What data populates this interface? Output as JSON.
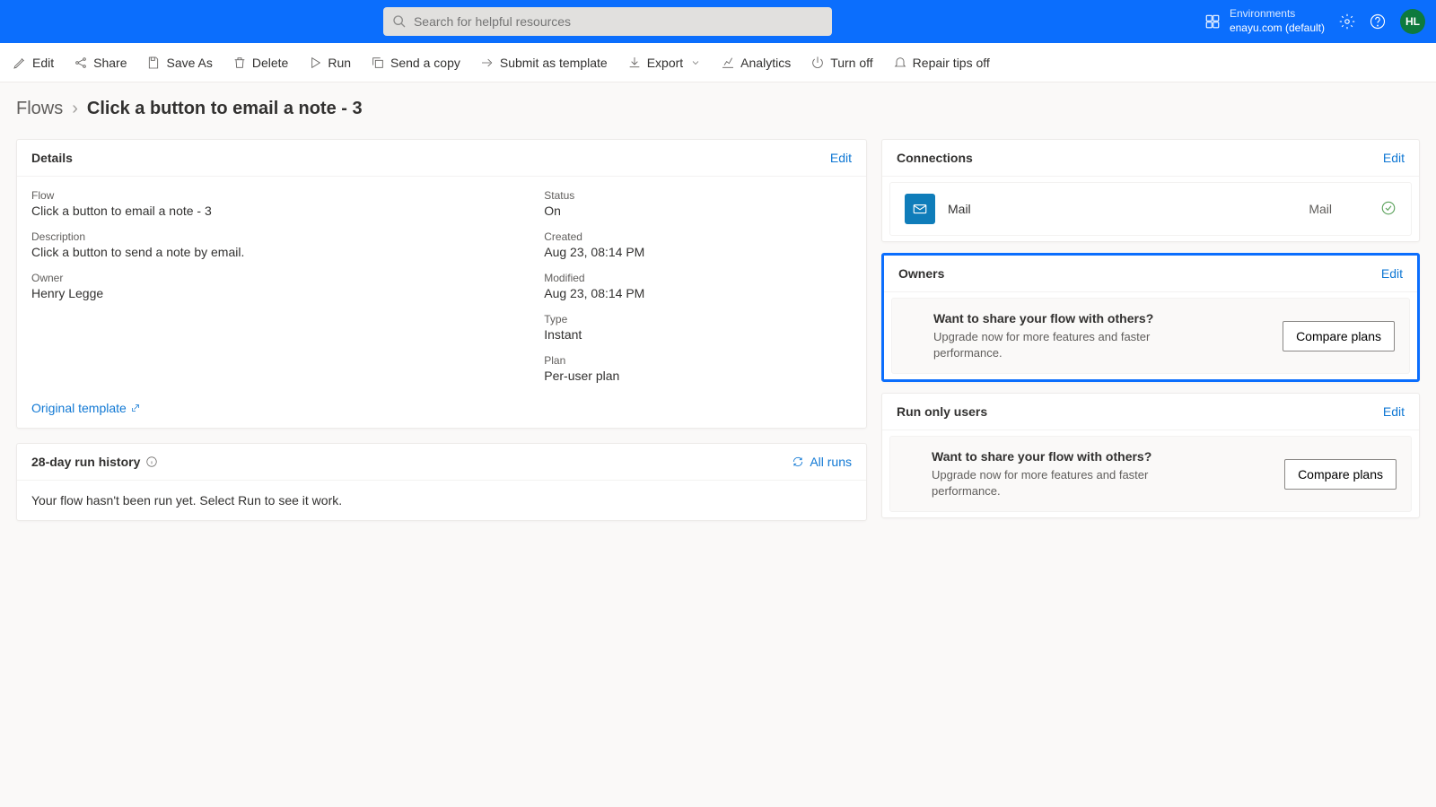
{
  "header": {
    "search_placeholder": "Search for helpful resources",
    "env_label": "Environments",
    "env_value": "enayu.com (default)",
    "avatar": "HL"
  },
  "cmdbar": {
    "edit": "Edit",
    "share": "Share",
    "saveas": "Save As",
    "delete": "Delete",
    "run": "Run",
    "sendcopy": "Send a copy",
    "submit": "Submit as template",
    "export": "Export",
    "analytics": "Analytics",
    "turnoff": "Turn off",
    "repair": "Repair tips off"
  },
  "breadcrumb": {
    "root": "Flows",
    "current": "Click a button to email a note - 3"
  },
  "details": {
    "title": "Details",
    "edit": "Edit",
    "flow_lbl": "Flow",
    "flow_val": "Click a button to email a note - 3",
    "desc_lbl": "Description",
    "desc_val": "Click a button to send a note by email.",
    "owner_lbl": "Owner",
    "owner_val": "Henry Legge",
    "status_lbl": "Status",
    "status_val": "On",
    "created_lbl": "Created",
    "created_val": "Aug 23, 08:14 PM",
    "modified_lbl": "Modified",
    "modified_val": "Aug 23, 08:14 PM",
    "type_lbl": "Type",
    "type_val": "Instant",
    "plan_lbl": "Plan",
    "plan_val": "Per-user plan",
    "orig_template": "Original template"
  },
  "history": {
    "title": "28-day run history",
    "allruns": "All runs",
    "empty": "Your flow hasn't been run yet. Select Run to see it work."
  },
  "connections": {
    "title": "Connections",
    "edit": "Edit",
    "name": "Mail",
    "type": "Mail"
  },
  "owners": {
    "title": "Owners",
    "edit": "Edit",
    "share_q": "Want to share your flow with others?",
    "share_d": "Upgrade now for more features and faster performance.",
    "compare": "Compare plans"
  },
  "runonly": {
    "title": "Run only users",
    "edit": "Edit",
    "share_q": "Want to share your flow with others?",
    "share_d": "Upgrade now for more features and faster performance.",
    "compare": "Compare plans"
  }
}
